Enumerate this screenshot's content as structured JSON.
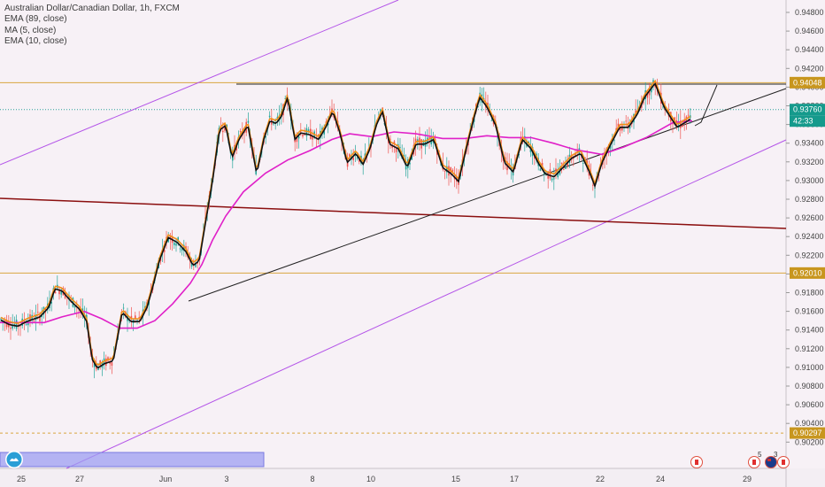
{
  "chart_data": {
    "type": "candlestick",
    "title": "Australian Dollar/Canadian Dollar, 1h, FXCM",
    "indicators": [
      "EMA (89, close)",
      "MA (5, close)",
      "EMA (10, close)"
    ],
    "y_ticks": [
      "0.94800",
      "0.94600",
      "0.94400",
      "0.94200",
      "0.94000",
      "0.93800",
      "0.93600",
      "0.93400",
      "0.93200",
      "0.93000",
      "0.92800",
      "0.92600",
      "0.92400",
      "0.92200",
      "0.92000",
      "0.91800",
      "0.91600",
      "0.91400",
      "0.91200",
      "0.91000",
      "0.90800",
      "0.90600",
      "0.90400",
      "0.90200"
    ],
    "x_ticks": [
      "25",
      "27",
      "Jun",
      "3",
      "8",
      "10",
      "15",
      "17",
      "22",
      "24",
      "29"
    ],
    "ylim": [
      0.9018,
      0.9488
    ],
    "price_labels": [
      {
        "value": "0.94048",
        "color": "#c8961e"
      },
      {
        "value": "0.93760",
        "color": "#159a8c"
      },
      {
        "value": "42:33",
        "color": "#159a8c"
      },
      {
        "value": "0.92010",
        "color": "#c8961e"
      },
      {
        "value": "0.90297",
        "color": "#c8961e"
      }
    ],
    "horizontal_levels": [
      0.94048,
      0.9201,
      0.90297
    ],
    "current_price": 0.9376,
    "ema89": [
      [
        0,
        0.9148
      ],
      [
        50,
        0.9148
      ],
      [
        70,
        0.9154
      ],
      [
        95,
        0.916
      ],
      [
        115,
        0.9152
      ],
      [
        135,
        0.9142
      ],
      [
        155,
        0.9142
      ],
      [
        175,
        0.915
      ],
      [
        195,
        0.9168
      ],
      [
        215,
        0.919
      ],
      [
        228,
        0.921
      ],
      [
        240,
        0.9236
      ],
      [
        255,
        0.9262
      ],
      [
        275,
        0.9288
      ],
      [
        300,
        0.9308
      ],
      [
        325,
        0.9322
      ],
      [
        350,
        0.9332
      ],
      [
        375,
        0.9344
      ],
      [
        395,
        0.935
      ],
      [
        420,
        0.9347
      ],
      [
        445,
        0.9352
      ],
      [
        470,
        0.935
      ],
      [
        500,
        0.9345
      ],
      [
        525,
        0.9345
      ],
      [
        550,
        0.9348
      ],
      [
        575,
        0.9346
      ],
      [
        600,
        0.9346
      ],
      [
        625,
        0.934
      ],
      [
        650,
        0.9333
      ],
      [
        680,
        0.9328
      ],
      [
        705,
        0.9336
      ],
      [
        730,
        0.9346
      ],
      [
        760,
        0.9362
      ],
      [
        782,
        0.9364
      ]
    ],
    "price_path": [
      [
        0,
        0.9152
      ],
      [
        10,
        0.9147
      ],
      [
        20,
        0.9145
      ],
      [
        30,
        0.915
      ],
      [
        45,
        0.9155
      ],
      [
        55,
        0.9165
      ],
      [
        62,
        0.9185
      ],
      [
        70,
        0.9183
      ],
      [
        80,
        0.9172
      ],
      [
        90,
        0.9163
      ],
      [
        98,
        0.915
      ],
      [
        104,
        0.911
      ],
      [
        110,
        0.91
      ],
      [
        118,
        0.9105
      ],
      [
        128,
        0.9108
      ],
      [
        138,
        0.916
      ],
      [
        148,
        0.915
      ],
      [
        158,
        0.915
      ],
      [
        166,
        0.9165
      ],
      [
        172,
        0.9185
      ],
      [
        180,
        0.9215
      ],
      [
        190,
        0.924
      ],
      [
        200,
        0.9235
      ],
      [
        210,
        0.9225
      ],
      [
        218,
        0.921
      ],
      [
        225,
        0.9215
      ],
      [
        232,
        0.9255
      ],
      [
        240,
        0.93
      ],
      [
        248,
        0.9355
      ],
      [
        255,
        0.936
      ],
      [
        262,
        0.9325
      ],
      [
        270,
        0.9345
      ],
      [
        280,
        0.936
      ],
      [
        290,
        0.9308
      ],
      [
        298,
        0.9345
      ],
      [
        305,
        0.9365
      ],
      [
        312,
        0.9362
      ],
      [
        318,
        0.937
      ],
      [
        325,
        0.939
      ],
      [
        333,
        0.9345
      ],
      [
        340,
        0.9352
      ],
      [
        350,
        0.935
      ],
      [
        360,
        0.9345
      ],
      [
        368,
        0.9358
      ],
      [
        376,
        0.9375
      ],
      [
        384,
        0.9352
      ],
      [
        392,
        0.932
      ],
      [
        402,
        0.933
      ],
      [
        410,
        0.9318
      ],
      [
        418,
        0.9335
      ],
      [
        425,
        0.936
      ],
      [
        432,
        0.9375
      ],
      [
        440,
        0.934
      ],
      [
        450,
        0.9335
      ],
      [
        460,
        0.9315
      ],
      [
        470,
        0.934
      ],
      [
        480,
        0.934
      ],
      [
        490,
        0.9345
      ],
      [
        500,
        0.9315
      ],
      [
        510,
        0.9308
      ],
      [
        518,
        0.93
      ],
      [
        528,
        0.934
      ],
      [
        536,
        0.937
      ],
      [
        542,
        0.939
      ],
      [
        550,
        0.938
      ],
      [
        560,
        0.936
      ],
      [
        570,
        0.932
      ],
      [
        580,
        0.931
      ],
      [
        590,
        0.9345
      ],
      [
        600,
        0.9335
      ],
      [
        608,
        0.932
      ],
      [
        616,
        0.9308
      ],
      [
        626,
        0.9305
      ],
      [
        636,
        0.9315
      ],
      [
        646,
        0.9325
      ],
      [
        656,
        0.933
      ],
      [
        666,
        0.931
      ],
      [
        672,
        0.9295
      ],
      [
        680,
        0.932
      ],
      [
        690,
        0.934
      ],
      [
        700,
        0.9358
      ],
      [
        710,
        0.9358
      ],
      [
        720,
        0.9372
      ],
      [
        728,
        0.939
      ],
      [
        740,
        0.9405
      ],
      [
        750,
        0.938
      ],
      [
        758,
        0.9368
      ],
      [
        765,
        0.9358
      ],
      [
        772,
        0.9362
      ],
      [
        782,
        0.9368
      ]
    ]
  }
}
